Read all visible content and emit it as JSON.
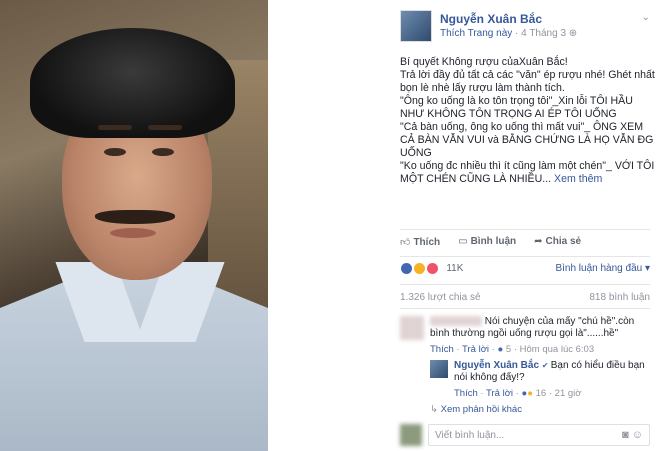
{
  "post": {
    "author": "Nguyễn Xuân Bắc",
    "like_page": "Thích Trang này",
    "date": "4 Tháng 3",
    "body": [
      "Bí quyết Không rượu củaXuân Bắc!",
      "Trả lời đầy đủ tất cả các \"văn\" ép rượu nhé! Ghét nhất bọn lè nhè lấy rượu làm thành tích.",
      "\"Ông ko uống là ko tôn trọng tôi\"_Xin lỗi TÔI HẦU NHƯ KHÔNG TÔN TRỌNG AI ÉP TÔI UỐNG",
      "\"Cả bàn uống, ông ko uống thì mất vui\"_ ÔNG XEM CẢ BÀN VẪN VUI và BẰNG CHỨNG LÀ HỌ VẪN ĐG UỐNG",
      "\"Ko uống đc nhiều thì ít cũng làm một chén\"_ VỚI TÔI MỘT CHÉN CŨNG LÀ NHIỀU..."
    ],
    "see_more": "Xem thêm"
  },
  "actions": {
    "like": "Thích",
    "comment": "Bình luận",
    "share": "Chia sẻ"
  },
  "reactions": {
    "count": "11K",
    "sort_label": "Bình luận hàng đầu ▾",
    "colors": {
      "like": "#4267b2",
      "haha": "#f7b125",
      "love": "#f25268"
    }
  },
  "stats": {
    "shares": "1.326 lượt chia sẻ",
    "comments": "818 bình luận"
  },
  "comment1": {
    "text": "Nói chuyện của mấy \"chú hề\".còn bình thường ngồi uống rượu gọi là\"......hề\"",
    "like": "Thích",
    "reply": "Trả lời",
    "reaction_count": "5",
    "time": "Hôm qua lúc 6:03"
  },
  "reply1": {
    "author": "Nguyễn Xuân Bắc",
    "text": "Bạn có hiểu điều bạn nói không đấy!?",
    "like": "Thích",
    "reply": "Trả lời",
    "reaction_count": "16",
    "time": "21 giờ"
  },
  "more_replies": "Xem phản hồi khác",
  "compose": {
    "placeholder": "Viết bình luận..."
  }
}
